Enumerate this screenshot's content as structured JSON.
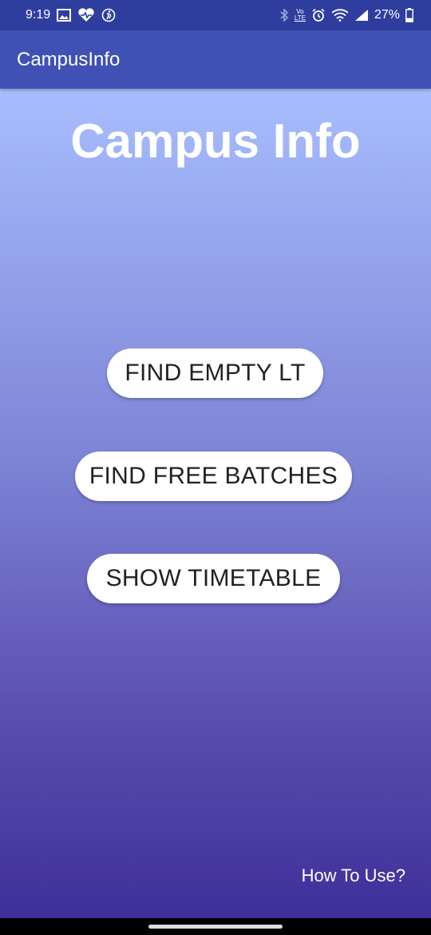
{
  "status_bar": {
    "time": "9:19",
    "left_icons": [
      "gallery-icon",
      "heart-rate-icon",
      "activity-icon"
    ],
    "right_icons": [
      "bluetooth-icon",
      "volte-icon",
      "alarm-icon",
      "wifi-icon",
      "signal-icon"
    ],
    "volte_label_top": "Vo",
    "volte_label_bottom": "LTE",
    "battery": "27%",
    "battery_level": 0.27
  },
  "app_bar": {
    "title": "CampusInfo",
    "color": "#3f51b5"
  },
  "main": {
    "heading": "Campus Info",
    "buttons": [
      {
        "label": "FIND EMPTY LT"
      },
      {
        "label": "FIND FREE BATCHES"
      },
      {
        "label": "SHOW TIMETABLE"
      }
    ],
    "help_link": "How To Use?"
  },
  "colors": {
    "status_bar": "#2f3e9e",
    "gradient_top": "#a8bdfd",
    "gradient_bottom": "#3f2f99",
    "button_bg": "#ffffff",
    "button_text": "#222222"
  }
}
